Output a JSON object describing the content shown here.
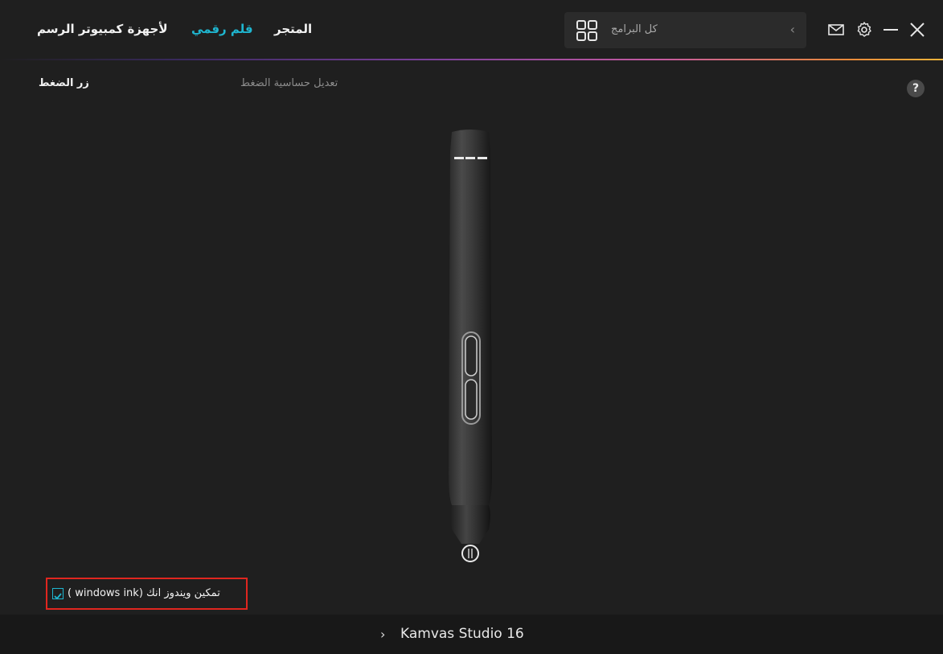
{
  "nav": {
    "drawing_devices": "لأجهزة كمبيوتر الرسم",
    "digital_pen": "قلم رقمي",
    "store": "المتجر"
  },
  "search": {
    "placeholder": "كل البرامج",
    "icon": "grid-icon",
    "chevron": "‹"
  },
  "window_controls": [
    "mail-icon",
    "gear-icon",
    "minimize-icon",
    "close-icon"
  ],
  "subtabs": {
    "press_button": "زر الضغط",
    "pressure_sensitivity": "تعديل حساسية الضغط"
  },
  "help": "?",
  "checkbox": {
    "label": "تمكين ويندوز انك (windows ink )",
    "checked": true
  },
  "footer": {
    "device": "Kamvas Studio 16",
    "chevron": "›"
  },
  "colors": {
    "accent": "#1fb6d0",
    "background": "#1f1f1f",
    "highlight_box": "#e0261f"
  }
}
